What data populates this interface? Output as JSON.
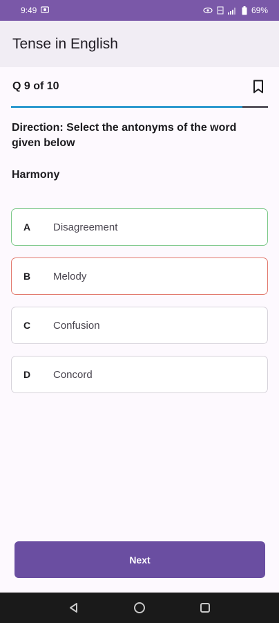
{
  "status_bar": {
    "time": "9:49",
    "battery": "69%"
  },
  "app_bar": {
    "title": "Tense in English"
  },
  "question": {
    "counter": "Q 9 of 10",
    "progress_fraction": 0.9,
    "direction": "Direction: Select the antonyms of the word given below",
    "word": "Harmony"
  },
  "options": [
    {
      "letter": "A",
      "text": "Disagreement",
      "state": "correct"
    },
    {
      "letter": "B",
      "text": "Melody",
      "state": "wrong"
    },
    {
      "letter": "C",
      "text": "Confusion",
      "state": "neutral"
    },
    {
      "letter": "D",
      "text": "Concord",
      "state": "neutral"
    }
  ],
  "next_button": {
    "label": "Next"
  },
  "colors": {
    "primary": "#6A4EA1",
    "progress": "#2F9ACF",
    "correct": "#7DC98A",
    "wrong": "#E27A6F"
  },
  "icons": [
    "gallery-icon",
    "eye-icon",
    "volte-icon",
    "signal-icon",
    "battery-icon",
    "bookmark-icon",
    "back-icon",
    "home-icon",
    "recents-icon"
  ]
}
